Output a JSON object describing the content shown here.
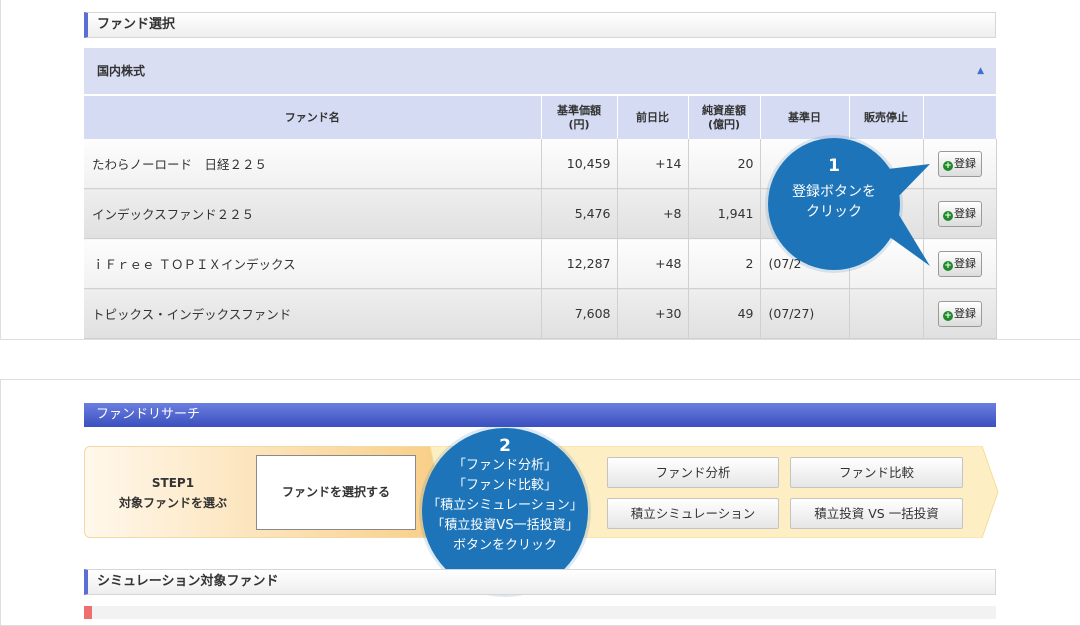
{
  "top_section": {
    "title": "ファンド選択",
    "category": {
      "label": "国内株式",
      "toggle_icon": "▲"
    },
    "table": {
      "headers": {
        "name": "ファンド名",
        "price_line1": "基準価額",
        "price_line2": "(円)",
        "change": "前日比",
        "assets_line1": "純資産額",
        "assets_line2": "(億円)",
        "date": "基準日",
        "stop": "販売停止",
        "action": ""
      },
      "rows": [
        {
          "name": "たわらノーロード　日経２２５",
          "price": "10,459",
          "change": "+14",
          "assets": "20",
          "date": "",
          "stop": "",
          "button": "登録"
        },
        {
          "name": "インデックスファンド２２５",
          "price": "5,476",
          "change": "+8",
          "assets": "1,941",
          "date": "",
          "stop": "",
          "button": "登録"
        },
        {
          "name": "ｉＦｒｅｅ ＴＯＰＩＸインデックス",
          "price": "12,287",
          "change": "+48",
          "assets": "2",
          "date": "(07/2",
          "stop": "",
          "button": "登録"
        },
        {
          "name": "トピックス・インデックスファンド",
          "price": "7,608",
          "change": "+30",
          "assets": "49",
          "date": "(07/27)",
          "stop": "",
          "button": "登録"
        }
      ]
    },
    "callout": {
      "number": "1",
      "line1": "登録ボタンを",
      "line2": "クリック"
    }
  },
  "bottom_section": {
    "title": "ファンドリサーチ",
    "step": {
      "line1": "STEP1",
      "line2": "対象ファンドを選ぶ"
    },
    "select_button": "ファンドを選択する",
    "buttons": {
      "analysis": "ファンド分析",
      "compare": "ファンド比較",
      "simulation": "積立シミュレーション",
      "vs": "積立投資 VS 一括投資"
    },
    "callout": {
      "number": "2",
      "lines": [
        "「ファンド分析」",
        "「ファンド比較」",
        "「積立シミュレーション」",
        "「積立投資VS一括投資」",
        "ボタンをクリック"
      ]
    },
    "sim_header": "シミュレーション対象ファンド"
  },
  "colors": {
    "callout_blue": "#1e74b8",
    "header_accent": "#5b6ed6",
    "research_bar": "#4a5ecb",
    "step_orange": "#f9cf88",
    "step_arrow": "#fce6a6",
    "add_icon_green": "#1f8a2a",
    "marker_red": "#ee6f6f"
  }
}
